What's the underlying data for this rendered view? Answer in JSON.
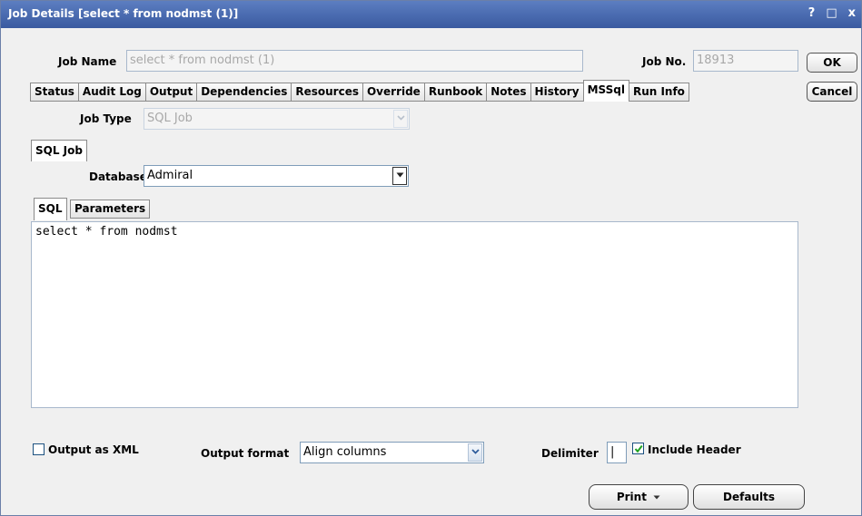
{
  "window": {
    "title": "Job Details [select * from nodmst (1)]",
    "controls": [
      "?",
      "□",
      "x"
    ]
  },
  "header": {
    "job_name_label": "Job Name",
    "job_name_value": "select * from nodmst (1)",
    "job_no_label": "Job No.",
    "job_no_value": "18913"
  },
  "side_buttons": {
    "ok": "OK",
    "cancel": "Cancel"
  },
  "tabs": [
    "Status",
    "Audit Log",
    "Output",
    "Dependencies",
    "Resources",
    "Override",
    "Runbook",
    "Notes",
    "History",
    "MSSql",
    "Run Info"
  ],
  "active_tab": "MSSql",
  "job_type": {
    "label": "Job Type",
    "value": "SQL Job"
  },
  "sql_job_tab": "SQL Job",
  "database": {
    "label": "Database",
    "value": "Admiral"
  },
  "sub_tabs": {
    "sql": "SQL",
    "parameters": "Parameters"
  },
  "sql_text": "select * from nodmst",
  "options": {
    "output_xml_label": "Output as XML",
    "output_xml_checked": false,
    "output_format_label": "Output format",
    "output_format_value": "Align columns",
    "delimiter_label": "Delimiter",
    "delimiter_value": "|",
    "include_header_label": "Include Header",
    "include_header_checked": true
  },
  "buttons": {
    "print": "Print",
    "defaults": "Defaults"
  }
}
